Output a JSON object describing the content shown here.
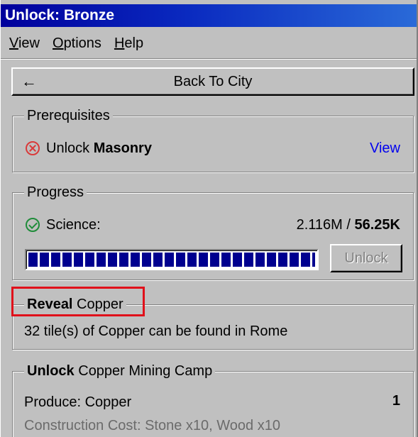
{
  "window": {
    "title": "Unlock: Bronze"
  },
  "menu": [
    {
      "accel": "V",
      "rest": "iew"
    },
    {
      "accel": "O",
      "rest": "ptions"
    },
    {
      "accel": "H",
      "rest": "elp"
    }
  ],
  "back_button": {
    "icon": "arrow-left-icon",
    "label": "Back To City"
  },
  "prerequisites": {
    "legend": "Prerequisites",
    "status_icon": "x-circle-icon",
    "status_color": "#d93a3a",
    "prefix": "Unlock",
    "name": "Masonry",
    "link": "View"
  },
  "progress": {
    "legend": "Progress",
    "status_icon": "check-circle-icon",
    "status_color": "#1f8c3a",
    "label": "Science:",
    "current": "2.116M",
    "separator": " / ",
    "required": "56.25K",
    "bar_fraction": 1.0,
    "bar_color": "#00008f",
    "unlock_label": "Unlock"
  },
  "reveal": {
    "legend_bold": "Reveal",
    "legend_rest": " Copper",
    "text": "32 tile(s) of Copper can be found in Rome",
    "highlight_color": "#e0101a"
  },
  "unlock_building": {
    "legend_bold": "Unlock",
    "legend_rest": " Copper Mining Camp",
    "produce_label": "Produce: Copper",
    "produce_qty": "1",
    "cost_text": "Construction Cost: Stone x10, Wood x10"
  }
}
